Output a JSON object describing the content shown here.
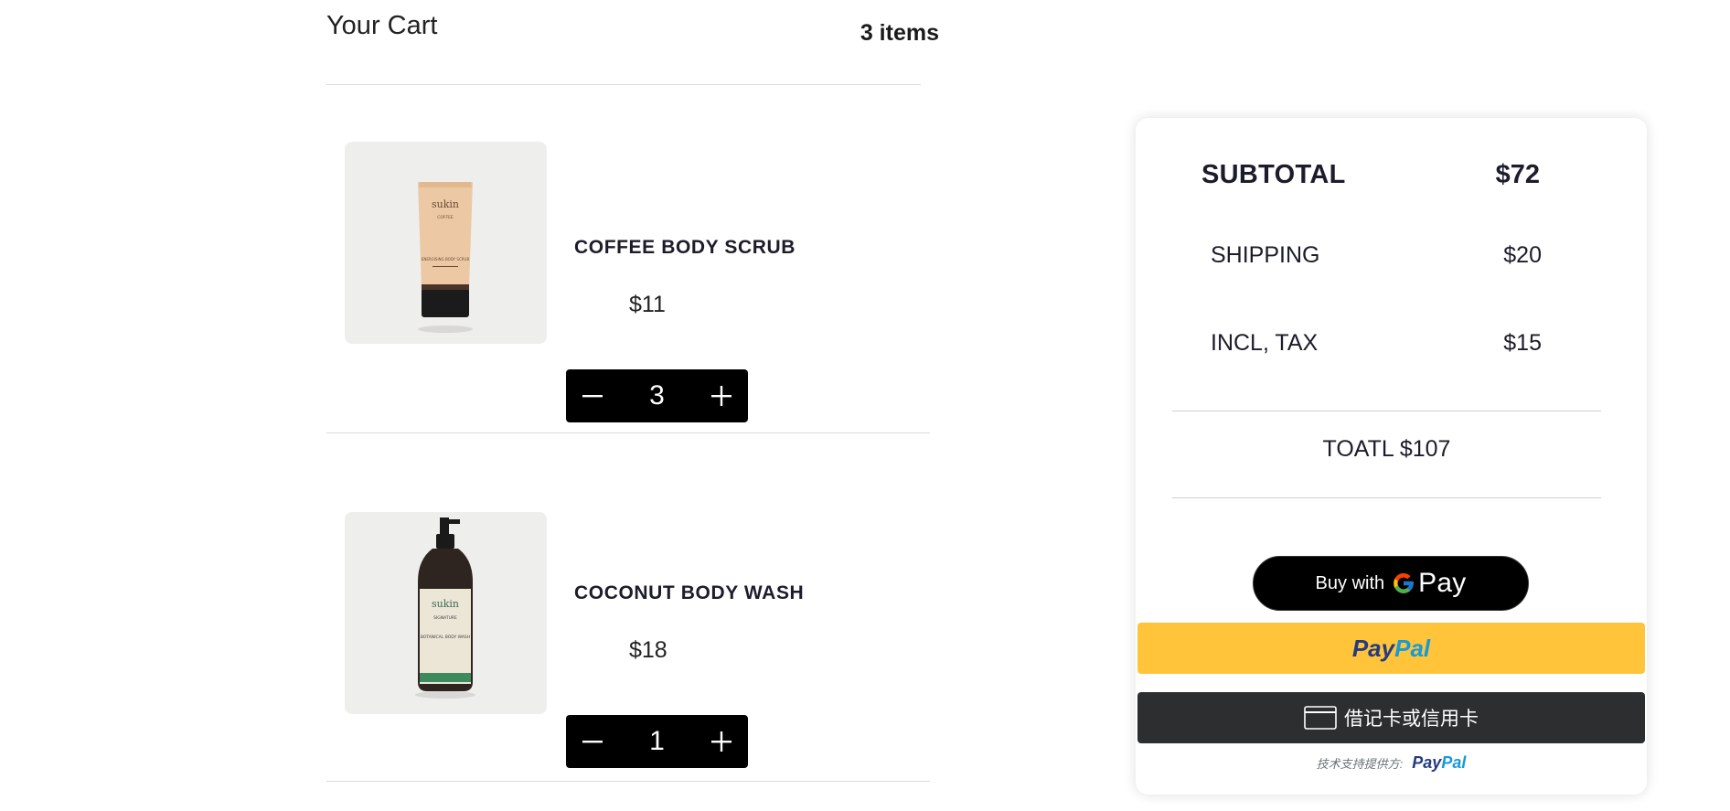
{
  "cart": {
    "title": "Your Cart",
    "count_label": "3 items",
    "items": [
      {
        "name": "COFFEE BODY SCRUB",
        "price": "$11",
        "quantity": "3",
        "image": "coffee-body-scrub-tube",
        "image_brand": "sukin",
        "image_variant": "COFFEE",
        "image_desc": "ENERGISING BODY SCRUB"
      },
      {
        "name": "COCONUT BODY WASH",
        "price": "$18",
        "quantity": "1",
        "image": "coconut-body-wash-bottle",
        "image_brand": "sukin",
        "image_variant": "SIGNATURE",
        "image_desc": "BOTANICAL BODY WASH"
      }
    ],
    "qty_controls": {
      "decrement_icon": "minus-icon",
      "increment_icon": "plus-icon"
    }
  },
  "summary": {
    "subtotal_label": "SUBTOTAL",
    "subtotal_value": "$72",
    "shipping_label": "SHIPPING",
    "shipping_value": "$20",
    "tax_label": "INCL, TAX",
    "tax_value": "$15",
    "total_label": "TOATL $107"
  },
  "payment": {
    "gpay_prefix": "Buy with",
    "gpay_brand": "Pay",
    "paypal_part1": "Pay",
    "paypal_part2": "Pal",
    "card_label": "借记卡或信用卡",
    "powered_text": "技术支持提供方:",
    "powered_part1": "Pay",
    "powered_part2": "Pal",
    "colors": {
      "paypal_yellow": "#ffc439",
      "paypal_navy": "#253b80",
      "paypal_blue": "#179bd7",
      "card_dark": "#2c2e2f"
    }
  }
}
